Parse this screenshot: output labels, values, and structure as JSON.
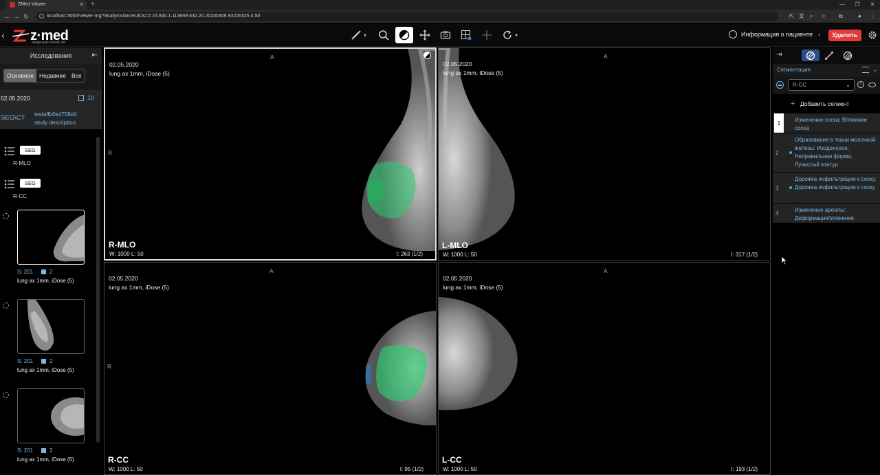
{
  "browser": {
    "tab_title": "ZMed Viewer",
    "url": "localhost:3000/viewer-mg?StudyInstanceUIDs=2.16.840.1.113669.632.20.20230406.93226325.4.50"
  },
  "header": {
    "logo_text": "z·med",
    "logo_sub": "МЕДИЦИНСКИЙ ИИ",
    "patient_info_label": "Информация о пациенте",
    "delete_label": "Удалить"
  },
  "left_panel": {
    "title": "Исследования",
    "tabs": [
      "Основное",
      "Недавнее",
      "Все"
    ],
    "study": {
      "date": "02.05.2020",
      "count": "10",
      "modality": "SEG\\CT",
      "id": "testaffb0e4708d4",
      "description": "study description"
    },
    "seg_series": [
      {
        "tag": "SEG",
        "label": "R-MLO"
      },
      {
        "tag": "SEG",
        "label": "R-CC"
      }
    ],
    "thumbnails": [
      {
        "series": "S: 201",
        "instances": "2",
        "description": "lung ax 1mm, iDose (5)"
      },
      {
        "series": "S: 201",
        "instances": "2",
        "description": "lung ax 1mm, iDose (5)"
      },
      {
        "series": "S: 201",
        "instances": "2",
        "description": "lung ax 1mm, iDose (5)"
      }
    ]
  },
  "viewports": [
    {
      "date": "02.05.2020",
      "series": "lung ax 1mm, iDose (5)",
      "orient_top": "A",
      "orient_left": "R",
      "view": "R-MLO",
      "wl": "W:  1000  L:  50",
      "index": "I: 263 (1/2)"
    },
    {
      "date": "02.05.2020",
      "series": "lung ax 1mm, iDose (5)",
      "orient_top": "A",
      "orient_left": "",
      "view": "L-MLO",
      "wl": "W:  1000  L:  50",
      "index": "I: 317 (1/2)"
    },
    {
      "date": "02.05.2020",
      "series": "lung ax 1mm, iDose (5)",
      "orient_top": "A",
      "orient_left": "R",
      "view": "R-CC",
      "wl": "W:  1000  L:  50",
      "index": "I: 95 (1/2)"
    },
    {
      "date": "02.05.2020",
      "series": "lung ax 1mm, iDose (5)",
      "orient_top": "A",
      "orient_left": "",
      "view": "L-CC",
      "wl": "W:  1000  L:  50",
      "index": "I: 193 (1/2)"
    }
  ],
  "right_panel": {
    "section_title": "Сегментация",
    "selected_seg": "R-CC",
    "add_segment_label": "Добавить сегмент",
    "segments": [
      {
        "num": "1",
        "text": "Изменение соска: Втяжение соска"
      },
      {
        "num": "2",
        "text": "Образование в ткани молочной железы: Изоденсное, Неправильная форма, Лучистый контур"
      },
      {
        "num": "3",
        "text": "Дорожка инфильтрации к соску: Дорожка инфильтрации к соску"
      },
      {
        "num": "4",
        "text": "Изменение ареолы: Деформация/втяжение"
      }
    ]
  },
  "colors": {
    "accent": "#7ab8e8",
    "delete": "#e03a3a",
    "segment_fill": "#2ecc71"
  }
}
